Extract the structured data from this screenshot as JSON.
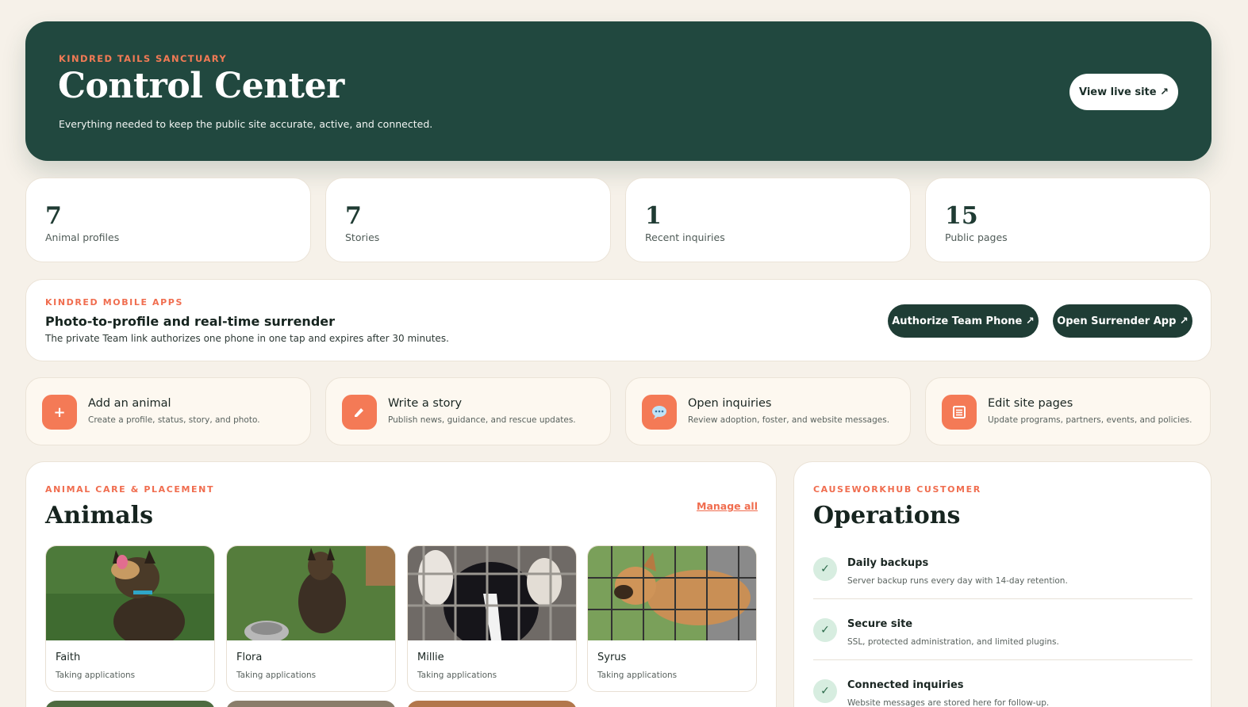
{
  "hero": {
    "eyebrow": "KINDRED TAILS SANCTUARY",
    "title": "Control Center",
    "subtitle": "Everything needed to keep the public site accurate, active, and connected.",
    "live_button": "View live site ↗"
  },
  "stats": [
    {
      "value": "7",
      "label": "Animal profiles"
    },
    {
      "value": "7",
      "label": "Stories"
    },
    {
      "value": "1",
      "label": "Recent inquiries"
    },
    {
      "value": "15",
      "label": "Public pages"
    }
  ],
  "mobile_apps": {
    "eyebrow": "KINDRED MOBILE APPS",
    "title": "Photo-to-profile and real-time surrender",
    "description": "The private Team link authorizes one phone in one tap and expires after 30 minutes.",
    "authorize_button": "Authorize Team Phone ↗",
    "surrender_button": "Open Surrender App ↗"
  },
  "quick_actions": [
    {
      "icon": "plus-icon",
      "title": "Add an animal",
      "desc": "Create a profile, status, story, and photo."
    },
    {
      "icon": "pencil-icon",
      "title": "Write a story",
      "desc": "Publish news, guidance, and rescue updates."
    },
    {
      "icon": "speech-bubble-icon",
      "title": "Open inquiries",
      "desc": "Review adoption, foster, and website messages."
    },
    {
      "icon": "document-icon",
      "title": "Edit site pages",
      "desc": "Update programs, partners, events, and policies."
    }
  ],
  "animals": {
    "eyebrow": "ANIMAL CARE & PLACEMENT",
    "title": "Animals",
    "manage_link": "Manage all",
    "items": [
      {
        "name": "Faith",
        "status": "Taking applications"
      },
      {
        "name": "Flora",
        "status": "Taking applications"
      },
      {
        "name": "Millie",
        "status": "Taking applications"
      },
      {
        "name": "Syrus",
        "status": "Taking applications"
      }
    ]
  },
  "operations": {
    "eyebrow": "CAUSEWORKHUB CUSTOMER",
    "title": "Operations",
    "items": [
      {
        "title": "Daily backups",
        "desc": "Server backup runs every day with 14-day retention."
      },
      {
        "title": "Secure site",
        "desc": "SSL, protected administration, and limited plugins."
      },
      {
        "title": "Connected inquiries",
        "desc": "Website messages are stored here for follow-up."
      }
    ]
  },
  "colors": {
    "hero_bg": "#21483f",
    "accent": "#f47a56",
    "dark_button": "#1f3d35",
    "page_bg": "#f6f1e9"
  }
}
